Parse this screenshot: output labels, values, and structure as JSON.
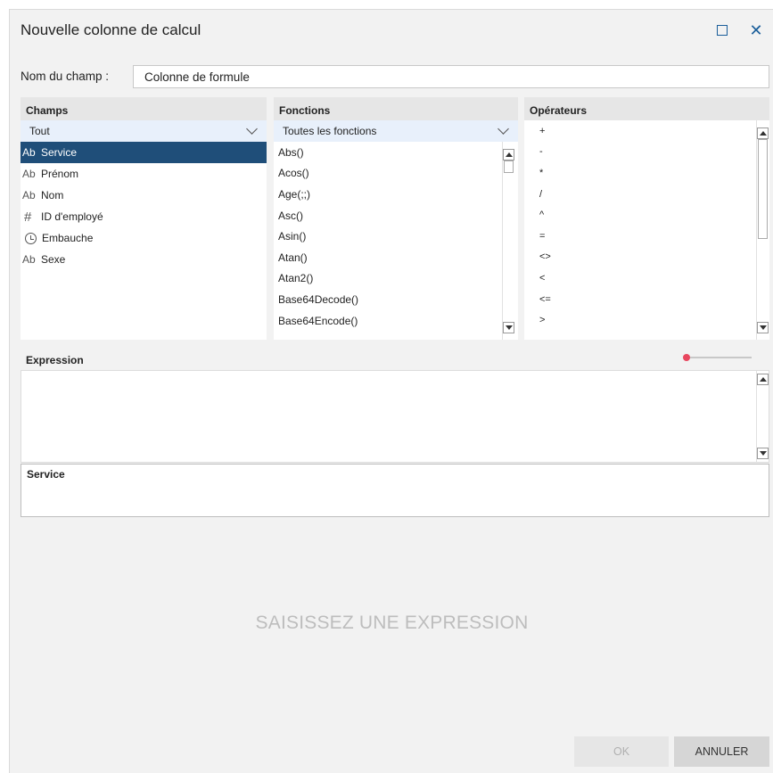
{
  "dialog": {
    "title": "Nouvelle colonne de calcul"
  },
  "field_name": {
    "label": "Nom du champ :",
    "value": "Colonne de formule"
  },
  "fields_panel": {
    "header": "Champs",
    "filter": "Tout",
    "items": [
      {
        "type_icon": "Ab",
        "label": "Service",
        "selected": true
      },
      {
        "type_icon": "Ab",
        "label": "Prénom"
      },
      {
        "type_icon": "Ab",
        "label": "Nom"
      },
      {
        "type_icon": "#",
        "label": "ID d'employé"
      },
      {
        "type_icon": "clock-icon",
        "label": "Embauche"
      },
      {
        "type_icon": "Ab",
        "label": "Sexe"
      }
    ]
  },
  "functions_panel": {
    "header": "Fonctions",
    "filter": "Toutes les fonctions",
    "items": [
      "Abs()",
      "Acos()",
      "Age(;;)",
      "Asc()",
      "Asin()",
      "Atan()",
      "Atan2()",
      "Base64Decode()",
      "Base64Encode()"
    ]
  },
  "operators_panel": {
    "header": "Opérateurs",
    "items": [
      "+",
      "-",
      "*",
      "/",
      "^",
      "=",
      "<>",
      "<",
      "<=",
      ">"
    ]
  },
  "expression": {
    "header": "Expression",
    "value": "",
    "info_title": "Service"
  },
  "message": "SAISISSEZ UNE EXPRESSION",
  "buttons": {
    "ok": "OK",
    "cancel": "ANNULER"
  },
  "colors": {
    "selected_row": "#1f4e79",
    "accent": "#e8475f",
    "window_icons": "#1a5e9a"
  }
}
